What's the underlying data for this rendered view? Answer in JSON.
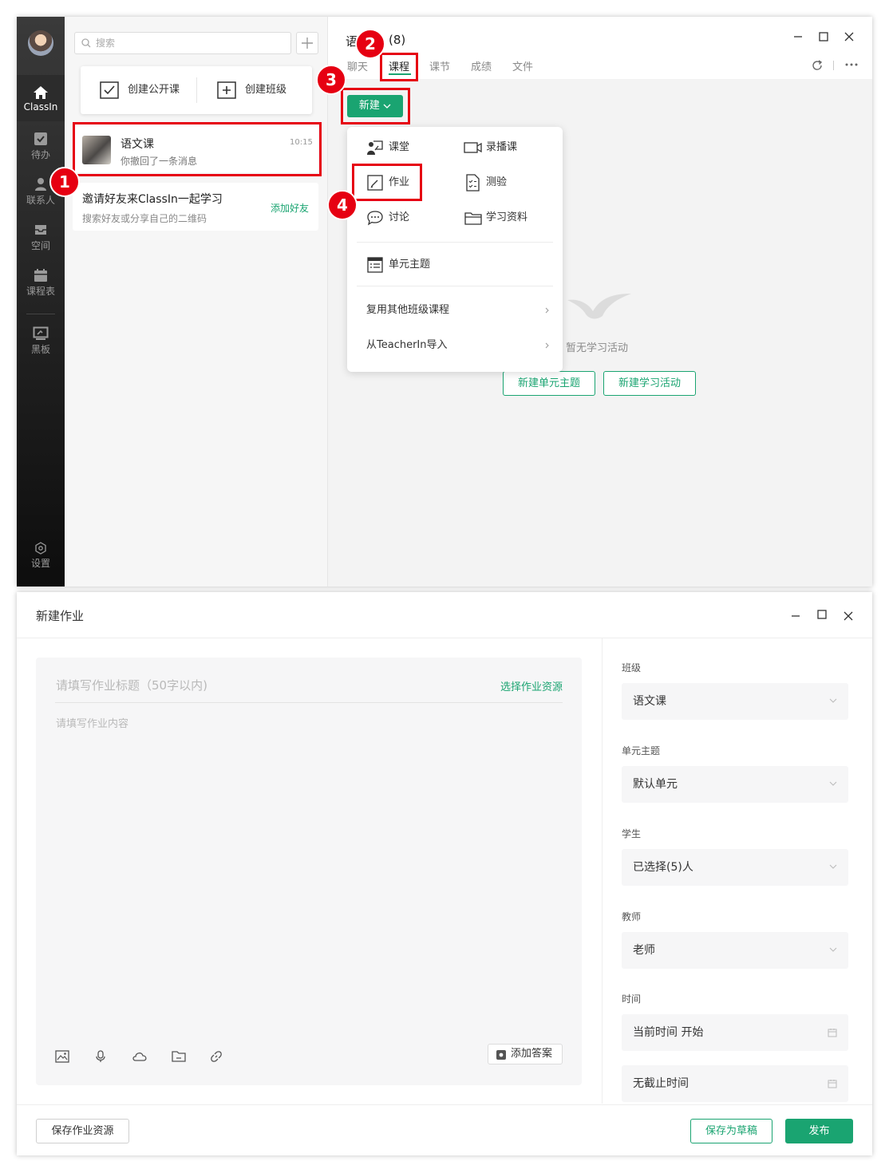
{
  "top_window": {
    "sidebar": {
      "items": [
        {
          "label": "ClassIn",
          "icon": "home-icon"
        },
        {
          "label": "待办",
          "icon": "todo-icon"
        },
        {
          "label": "联系人",
          "icon": "contacts-icon"
        },
        {
          "label": "空间",
          "icon": "inbox-icon"
        },
        {
          "label": "课程表",
          "icon": "calendar-icon"
        },
        {
          "label": "黑板",
          "icon": "blackboard-icon"
        }
      ],
      "settings_label": "设置"
    },
    "search": {
      "placeholder": "搜索"
    },
    "create_card": {
      "open_class": "创建公开课",
      "create_class": "创建班级"
    },
    "chat_item": {
      "name": "语文课",
      "time": "10:15",
      "preview": "你撤回了一条消息"
    },
    "invite": {
      "title": "邀请好友来ClassIn一起学习",
      "subtitle": "搜索好友或分享自己的二维码",
      "action": "添加好友"
    },
    "header": {
      "title_start": "语",
      "title_end": "(8)"
    },
    "tabs": [
      "聊天",
      "课程",
      "课节",
      "成绩",
      "文件"
    ],
    "new_button": "新建",
    "menu": {
      "classroom": "课堂",
      "recorded": "录播课",
      "homework": "作业",
      "quiz": "测验",
      "discussion": "讨论",
      "materials": "学习资料",
      "unit_topic": "单元主题",
      "reuse": "复用其他班级课程",
      "import": "从TeacherIn导入"
    },
    "empty": {
      "text": "暂无学习活动",
      "new_unit": "新建单元主题",
      "new_activity": "新建学习活动"
    },
    "badges": [
      "1",
      "2",
      "3",
      "4"
    ]
  },
  "bottom_window": {
    "title": "新建作业",
    "editor": {
      "title_placeholder": "请填写作业标题（50字以内)",
      "select_resource": "选择作业资源",
      "content_placeholder": "请填写作业内容",
      "add_answer": "添加答案"
    },
    "fields": {
      "class_label": "班级",
      "class_value": "语文课",
      "unit_label": "单元主题",
      "unit_value": "默认单元",
      "student_label": "学生",
      "student_value": "已选择(5)人",
      "teacher_label": "教师",
      "teacher_value": "老师",
      "time_label": "时间",
      "time_start": "当前时间 开始",
      "time_end": "无截止时间"
    },
    "footer": {
      "save_resource": "保存作业资源",
      "save_draft": "保存为草稿",
      "publish": "发布"
    }
  },
  "colors": {
    "accent": "#1aa471",
    "highlight": "#e60012",
    "sidebar": "#1a1a1a"
  }
}
